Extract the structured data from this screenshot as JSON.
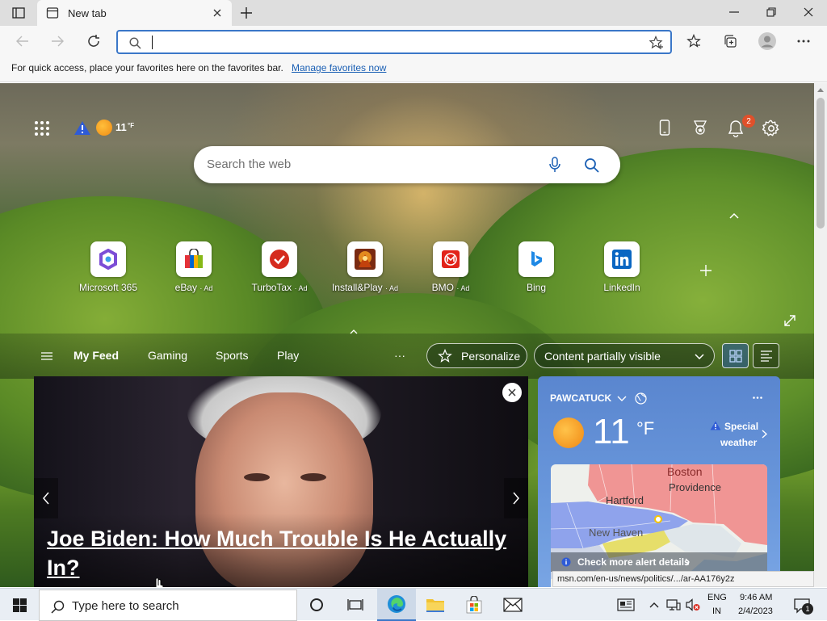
{
  "browser": {
    "tab_title": "New tab",
    "address_value": "",
    "favbar_text": "For quick access, place your favorites here on the favorites bar.",
    "favbar_link": "Manage favorites now"
  },
  "msn": {
    "weather_temp": "11",
    "weather_unit": "°F",
    "notification_count": "2",
    "search_placeholder": "Search the web",
    "tiles": [
      {
        "label": "Microsoft 365",
        "ad": ""
      },
      {
        "label": "eBay",
        "ad": "· Ad"
      },
      {
        "label": "TurboTax",
        "ad": "· Ad"
      },
      {
        "label": "Install&Play",
        "ad": "· Ad"
      },
      {
        "label": "BMO",
        "ad": "· Ad"
      },
      {
        "label": "Bing",
        "ad": ""
      },
      {
        "label": "LinkedIn",
        "ad": ""
      }
    ],
    "feed_nav": [
      "My Feed",
      "Gaming",
      "Sports",
      "Play"
    ],
    "more_label": "···",
    "personalize_label": "Personalize",
    "content_select": "Content partially visible",
    "hero_headline": "Joe Biden: How Much Trouble Is He Actually In?",
    "weather_card": {
      "location": "PAWCATUCK",
      "temp": "11",
      "unit": "°F",
      "alert_line1": "Special",
      "alert_line2": "weather",
      "map_cities": [
        "Boston",
        "Providence",
        "Hartford",
        "New Haven"
      ],
      "alert_link": "Check more alert details"
    },
    "status_url": "msn.com/en-us/news/politics/.../ar-AA176y2z"
  },
  "taskbar": {
    "search_placeholder": "Type here to search",
    "lang1": "ENG",
    "lang2": "IN",
    "time": "9:46 AM",
    "date": "2/4/2023",
    "notif_count": "1"
  },
  "colors": {
    "accent": "#3b77c8",
    "link": "#1a5fb4",
    "sun": "#f39a1f",
    "bell_badge": "#e0502a"
  }
}
